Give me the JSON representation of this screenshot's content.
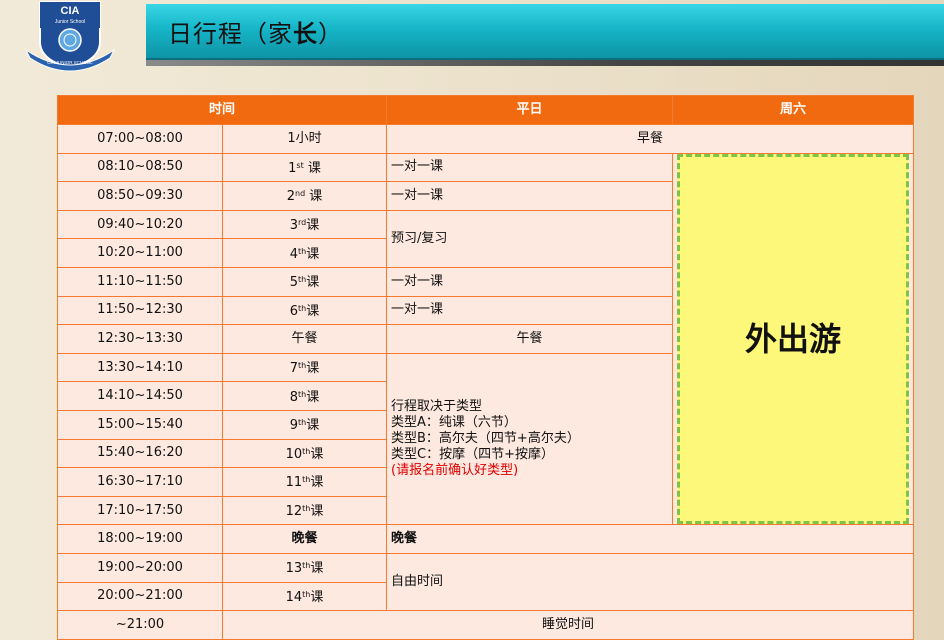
{
  "logo": {
    "brand": "CIA",
    "subtitle": "Junior School",
    "arc_text": "CIA JUNIOR SCHOOL"
  },
  "banner": {
    "title_prefix": "日行程（家",
    "title_bold": "长",
    "title_suffix": "）"
  },
  "headers": {
    "time": "时间",
    "weekday": "平日",
    "saturday": "周六"
  },
  "rows": [
    {
      "time": "07:00~08:00",
      "label": "1小时"
    },
    {
      "time": "08:10~08:50",
      "num": "1",
      "sup": "st",
      "suffix": " 课"
    },
    {
      "time": "08:50~09:30",
      "num": "2",
      "sup": "nd",
      "suffix": " 课"
    },
    {
      "time": "09:40~10:20",
      "num": "3",
      "sup": "rd",
      "suffix": "课"
    },
    {
      "time": "10:20~11:00",
      "num": "4",
      "sup": "th",
      "suffix": "课"
    },
    {
      "time": "11:10~11:50",
      "num": "5",
      "sup": "th",
      "suffix": "课"
    },
    {
      "time": "11:50~12:30",
      "num": "6",
      "sup": "th",
      "suffix": "课"
    },
    {
      "time": "12:30~13:30",
      "label": "午餐"
    },
    {
      "time": "13:30~14:10",
      "num": "7",
      "sup": "th",
      "suffix": "课"
    },
    {
      "time": "14:10~14:50",
      "num": "8",
      "sup": "th",
      "suffix": "课"
    },
    {
      "time": "15:00~15:40",
      "num": "9",
      "sup": "th",
      "suffix": "课"
    },
    {
      "time": "15:40~16:20",
      "num": "10",
      "sup": "th",
      "suffix": "课"
    },
    {
      "time": "16:30~17:10",
      "num": "11",
      "sup": "th",
      "suffix": "课"
    },
    {
      "time": "17:10~17:50",
      "num": "12",
      "sup": "th",
      "suffix": "课"
    },
    {
      "time": "18:00~19:00",
      "label": "晚餐"
    },
    {
      "time": "19:00~20:00",
      "num": "13",
      "sup": "th",
      "suffix": "课"
    },
    {
      "time": "20:00~21:00",
      "num": "14",
      "sup": "th",
      "suffix": "课"
    },
    {
      "time": "~21:00"
    }
  ],
  "weekday": {
    "breakfast": "早餐",
    "one_on_one": "一对一课",
    "review": "预习/复习",
    "lunch": "午餐",
    "notes": {
      "line1": "行程取决于类型",
      "line2": "类型A：纯课（六节）",
      "line3": "类型B：高尔夫（四节+高尔夫）",
      "line4": "类型C：按摩（四节+按摩）",
      "line5": "(请报名前确认好类型)"
    },
    "dinner": "晚餐",
    "free_time": "自由时间",
    "sleep": "睡觉时间"
  },
  "saturday": {
    "outing": "外出游"
  },
  "colors": {
    "header": "#f26a10",
    "cell": "#fde9e0",
    "border": "#f47a30",
    "outing": "#fdf77a",
    "outing_border": "#7ec34a",
    "banner": "#16b6c8",
    "note_red": "#e00000"
  }
}
